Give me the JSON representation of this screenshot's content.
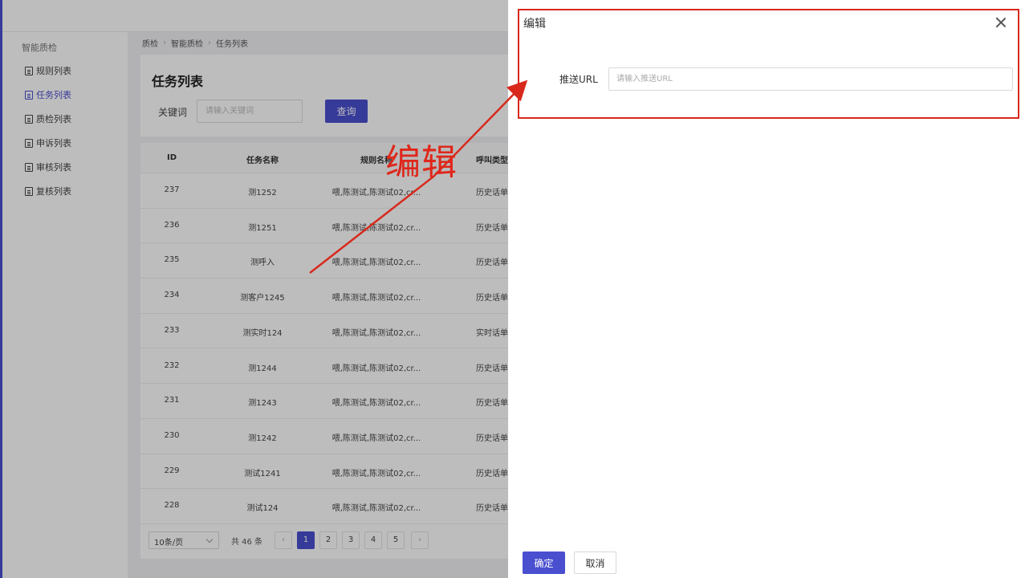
{
  "sidebar": {
    "title": "智能质检",
    "items": [
      {
        "label": "规则列表",
        "active": false
      },
      {
        "label": "任务列表",
        "active": true
      },
      {
        "label": "质检列表",
        "active": false
      },
      {
        "label": "申诉列表",
        "active": false
      },
      {
        "label": "审核列表",
        "active": false
      },
      {
        "label": "复核列表",
        "active": false
      }
    ]
  },
  "breadcrumb": [
    "质检",
    "智能质检",
    "任务列表"
  ],
  "page": {
    "title": "任务列表",
    "keyword_label": "关键词",
    "keyword_placeholder": "请输入关键词",
    "query_button": "查询"
  },
  "table": {
    "columns": [
      "ID",
      "任务名称",
      "规则名称",
      "呼叫类型"
    ],
    "rows": [
      [
        "237",
        "测1252",
        "喂,陈测试,陈测试02,cr...",
        "历史话单"
      ],
      [
        "236",
        "测1251",
        "喂,陈测试,陈测试02,cr...",
        "历史话单"
      ],
      [
        "235",
        "测呼入",
        "喂,陈测试,陈测试02,cr...",
        "历史话单"
      ],
      [
        "234",
        "测客户1245",
        "喂,陈测试,陈测试02,cr...",
        "历史话单"
      ],
      [
        "233",
        "测实时124",
        "喂,陈测试,陈测试02,cr...",
        "实时话单"
      ],
      [
        "232",
        "测1244",
        "喂,陈测试,陈测试02,cr...",
        "历史话单"
      ],
      [
        "231",
        "测1243",
        "喂,陈测试,陈测试02,cr...",
        "历史话单"
      ],
      [
        "230",
        "测1242",
        "喂,陈测试,陈测试02,cr...",
        "历史话单"
      ],
      [
        "229",
        "测试1241",
        "喂,陈测试,陈测试02,cr...",
        "历史话单"
      ],
      [
        "228",
        "测试124",
        "喂,陈测试,陈测试02,cr...",
        "历史话单"
      ]
    ]
  },
  "pagination": {
    "page_size": "10条/页",
    "total": "共 46 条",
    "pages": [
      "1",
      "2",
      "3",
      "4",
      "5"
    ],
    "current": "1",
    "prev_icon": "‹",
    "next_icon": "›"
  },
  "drawer": {
    "title": "编辑",
    "url_label": "推送URL",
    "url_placeholder": "请输入推送URL",
    "ok_button": "确定",
    "cancel_button": "取消"
  },
  "annotation": {
    "text": "编辑",
    "color": "#e0261a"
  },
  "colors": {
    "accent": "#4a4fcf",
    "annotation": "#d8291c"
  }
}
